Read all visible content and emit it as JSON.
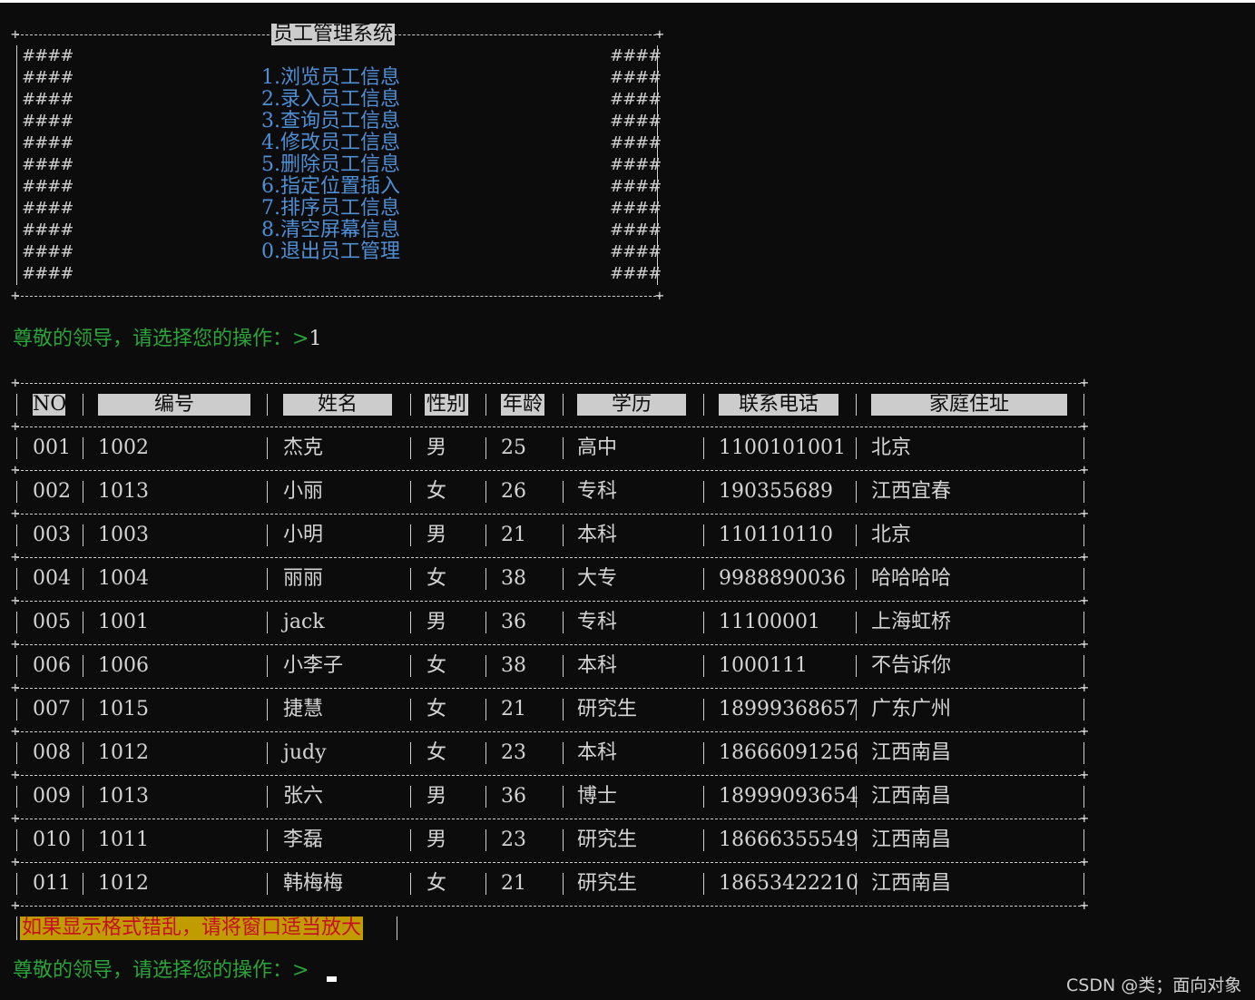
{
  "window": {
    "title": "员工管理系统"
  },
  "menu": {
    "border_hash": "####",
    "items": [
      "1.浏览员工信息",
      "2.录入员工信息",
      "3.查询员工信息",
      "4.修改员工信息",
      "5.删除员工信息",
      "6.指定位置插入",
      "7.排序员工信息",
      "8.清空屏幕信息",
      "0.退出员工管理"
    ]
  },
  "prompt1": {
    "text": "尊敬的领导，请选择您的操作：>",
    "input": "1"
  },
  "table": {
    "headers": [
      "NO",
      "编号",
      "姓名",
      "性别",
      "年龄",
      "学历",
      "联系电话",
      "家庭住址"
    ],
    "rows": [
      [
        "001",
        "1002",
        "杰克",
        "男",
        "25",
        "高中",
        "1100101001",
        "北京"
      ],
      [
        "002",
        "1013",
        "小丽",
        "女",
        "26",
        "专科",
        "190355689",
        "江西宜春"
      ],
      [
        "003",
        "1003",
        "小明",
        "男",
        "21",
        "本科",
        "110110110",
        "北京"
      ],
      [
        "004",
        "1004",
        "丽丽",
        "女",
        "38",
        "大专",
        "9988890036",
        "哈哈哈哈"
      ],
      [
        "005",
        "1001",
        "jack",
        "男",
        "36",
        "专科",
        "11100001",
        "上海虹桥"
      ],
      [
        "006",
        "1006",
        "小李子",
        "女",
        "38",
        "本科",
        "1000111",
        "不告诉你"
      ],
      [
        "007",
        "1015",
        "捷慧",
        "女",
        "21",
        "研究生",
        "18999368657",
        "广东广州"
      ],
      [
        "008",
        "1012",
        "judy",
        "女",
        "23",
        "本科",
        "18666091256",
        "江西南昌"
      ],
      [
        "009",
        "1013",
        "张六",
        "男",
        "36",
        "博士",
        "18999093654",
        "江西南昌"
      ],
      [
        "010",
        "1011",
        "李磊",
        "男",
        "23",
        "研究生",
        "18666355549",
        "江西南昌"
      ],
      [
        "011",
        "1012",
        "韩梅梅",
        "女",
        "21",
        "研究生",
        "18653422210",
        "江西南昌"
      ]
    ]
  },
  "warning": "如果显示格式错乱，请将窗口适当放大",
  "prompt2": {
    "text": "尊敬的领导，请选择您的操作：>"
  },
  "watermark": "CSDN @类；面向对象",
  "colors": {
    "background": "#0c0c0c",
    "menu_text": "#4f8fd6",
    "prompt_text": "#2aa33a",
    "warning_bg": "#c19c00",
    "warning_text": "#c50f1f"
  }
}
